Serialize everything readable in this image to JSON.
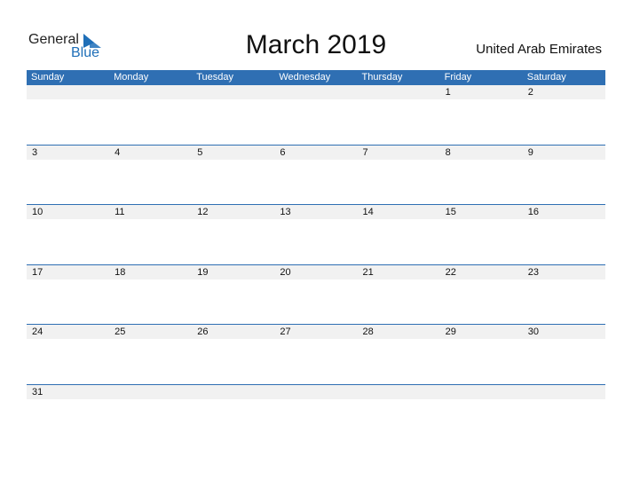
{
  "logo": {
    "line1": "General",
    "line2": "Blue",
    "brand_color": "#1f6fb8",
    "icon": "general-blue-logo-icon"
  },
  "title": "March 2019",
  "country": "United Arab Emirates",
  "colors": {
    "header_bg": "#2f6fb3",
    "date_band_bg": "#f1f1f1",
    "header_text": "#ffffff"
  },
  "weekdays": [
    "Sunday",
    "Monday",
    "Tuesday",
    "Wednesday",
    "Thursday",
    "Friday",
    "Saturday"
  ],
  "weeks": [
    [
      "",
      "",
      "",
      "",
      "",
      "1",
      "2"
    ],
    [
      "3",
      "4",
      "5",
      "6",
      "7",
      "8",
      "9"
    ],
    [
      "10",
      "11",
      "12",
      "13",
      "14",
      "15",
      "16"
    ],
    [
      "17",
      "18",
      "19",
      "20",
      "21",
      "22",
      "23"
    ],
    [
      "24",
      "25",
      "26",
      "27",
      "28",
      "29",
      "30"
    ],
    [
      "31",
      "",
      "",
      "",
      "",
      "",
      ""
    ]
  ]
}
